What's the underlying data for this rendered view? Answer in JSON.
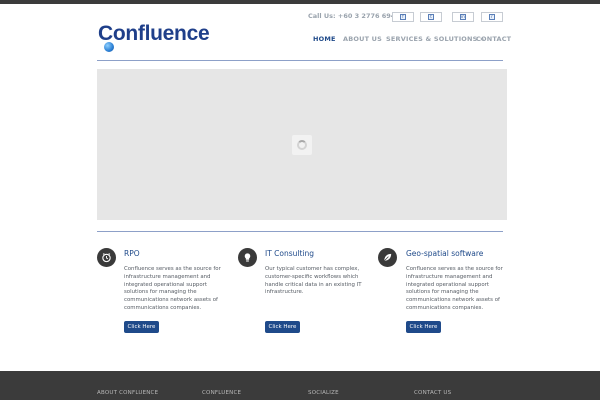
{
  "header": {
    "logo_text": "Confluence",
    "call_us": "Call Us: +60 3 2776 6945",
    "social_icons": [
      "facebook-icon",
      "twitter-icon",
      "linkedin-icon",
      "rss-icon"
    ]
  },
  "nav": {
    "items": [
      {
        "label": "HOME",
        "active": true
      },
      {
        "label": "ABOUT US",
        "active": false
      },
      {
        "label": "SERVICES & SOLUTIONS »",
        "active": false
      },
      {
        "label": "CONTACT",
        "active": false
      }
    ]
  },
  "slider": {
    "loading_icon": "spinner-icon"
  },
  "features": [
    {
      "icon": "clock-icon",
      "title": "RPO",
      "text": "Confluence serves as the source for infrastructure management and integrated operational support solutions for managing the communications network assets of communications companies.",
      "button": "Click Here"
    },
    {
      "icon": "lightbulb-icon",
      "title": "IT Consulting",
      "text": "Our typical customer has complex, customer-specific workflows which handle critical data in an existing IT infrastructure.",
      "button": "Click Here"
    },
    {
      "icon": "leaf-icon",
      "title": "Geo-spatial software",
      "text": "Confluence serves as the source for infrastructure management and integrated operational support solutions for managing the communications network assets of communications companies.",
      "button": "Click Here"
    }
  ],
  "footer": {
    "columns": [
      "ABOUT CONFLUENCE",
      "CONFLUENCE",
      "SOCIALIZE",
      "CONTACT US"
    ]
  },
  "colors": {
    "brand": "#1f4a8a",
    "footer_bg": "#3b3b3b",
    "slider_bg": "#e6e6e6"
  }
}
